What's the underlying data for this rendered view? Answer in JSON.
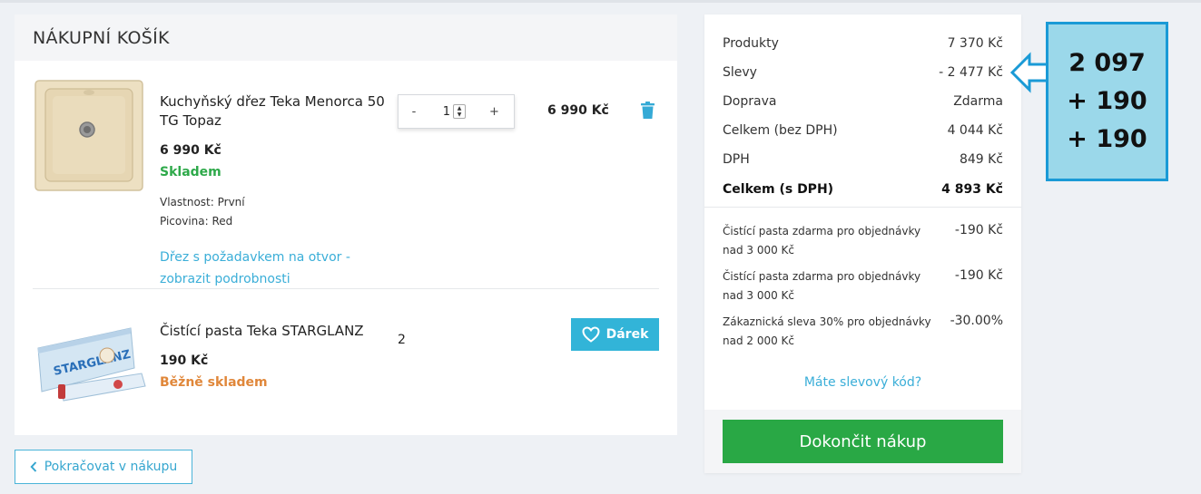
{
  "cart": {
    "title": "NÁKUPNÍ KOŠÍK",
    "items": [
      {
        "name": "Kuchyňský dřez Teka Menorca 50 TG Topaz",
        "price": "6 990 Kč",
        "stock": "Skladem",
        "attributes": [
          "Vlastnost: První",
          "Picovina: Red"
        ],
        "link": "Dřez s požadavkem na otvor - zobrazit podrobnosti",
        "quantity": "1",
        "qty_minus": "-",
        "qty_plus": "+",
        "total": "6 990 Kč",
        "delete_icon": "trash-icon"
      },
      {
        "name": "Čistící pasta Teka STARGLANZ",
        "price": "190 Kč",
        "stock": "Běžně skladem",
        "quantity": "2",
        "gift_label": "Dárek",
        "gift_icon": "heart-icon",
        "image_logo": "STARGLANZ"
      }
    ],
    "back_label": "Pokračovat v nákupu"
  },
  "summary": {
    "rows": [
      {
        "label": "Produkty",
        "value": "7 370 Kč"
      },
      {
        "label": "Slevy",
        "value": "- 2 477 Kč"
      },
      {
        "label": "Doprava",
        "value": "Zdarma"
      },
      {
        "label": "Celkem (bez DPH)",
        "value": "4 044 Kč"
      },
      {
        "label": "DPH",
        "value": "849 Kč"
      },
      {
        "label": "Celkem (s DPH)",
        "value": "4 893 Kč"
      }
    ],
    "discounts": [
      {
        "text": "Čistící pasta zdarma pro objednávky nad 3 000 Kč",
        "amount": "-190 Kč"
      },
      {
        "text": "Čistící pasta zdarma pro objednávky nad 3 000 Kč",
        "amount": "-190 Kč"
      },
      {
        "text": "Zákaznická sleva 30% pro objednávky nad 2 000 Kč",
        "amount": "-30.00%"
      }
    ],
    "coupon_link": "Máte slevový kód?",
    "finish_label": "Dokončit nákup"
  },
  "annotation": {
    "lines": [
      "2 097",
      "+ 190",
      "+ 190"
    ]
  },
  "colors": {
    "accent": "#32b4d8",
    "success": "#29a845",
    "stock_in": "#2ea94a",
    "stock_normal": "#e0873a",
    "annotation_bg": "#9bd8ea",
    "annotation_border": "#1a9ad6"
  }
}
